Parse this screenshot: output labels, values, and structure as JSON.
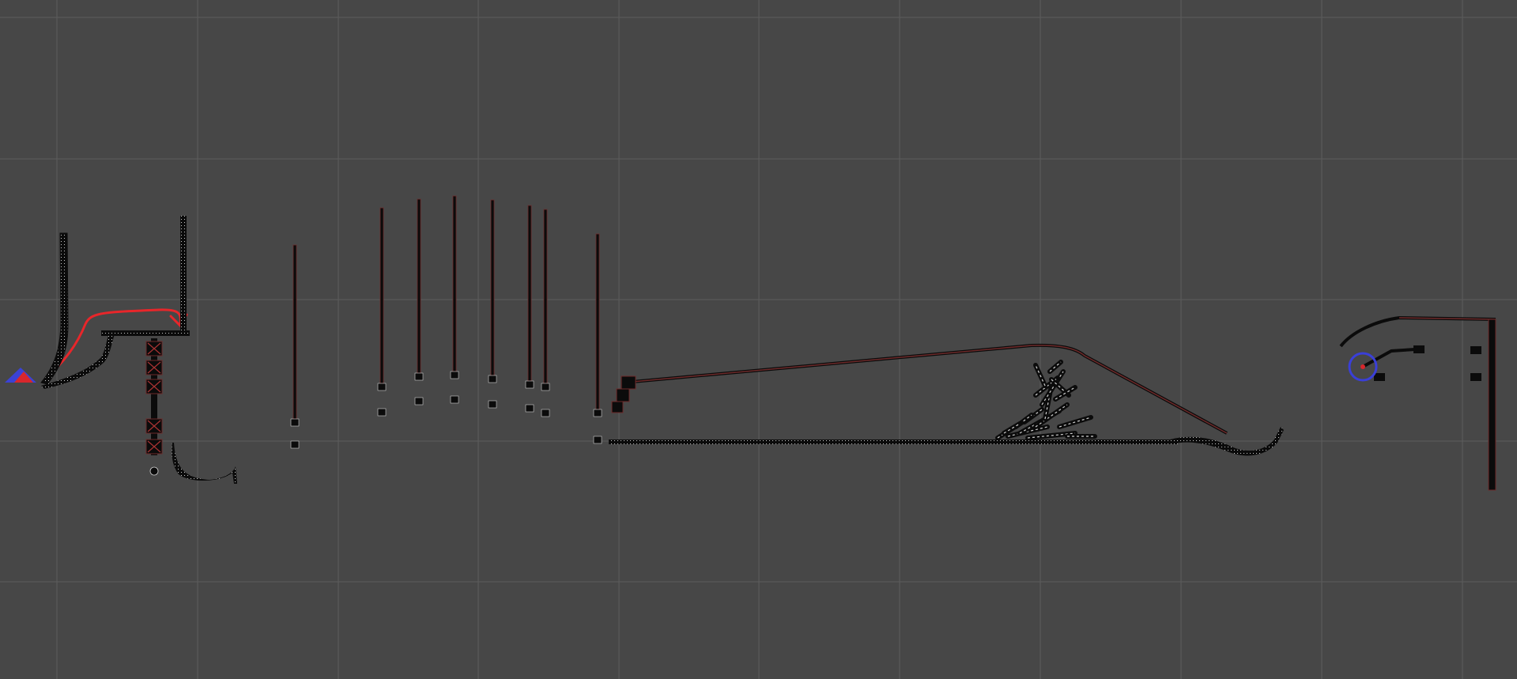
{
  "viewport": {
    "kind": "2d-scene-view",
    "grid": true,
    "colors": {
      "background": "#474747",
      "grid_line": "#5c5c5c",
      "object_outline": "#0b0b0b",
      "selection_outline": "#6e2a2a",
      "annotation_red": "#e8262a",
      "player_blue": "#3b42d6",
      "player_red": "#d8272c",
      "target_circle": "#3a3fd8"
    }
  },
  "annotations": {
    "path_arrow": {
      "kind": "freehand-arrow",
      "color": "#e8262a"
    },
    "target_marker": {
      "kind": "circle",
      "color": "#3a3fd8"
    }
  },
  "objects": {
    "player_marker": {
      "icon": "triangle-player-icon"
    },
    "stacked_debris": {
      "icon": "debris-pile-icon"
    },
    "hinged_chain": {
      "icon": "x-joint-icon"
    }
  }
}
